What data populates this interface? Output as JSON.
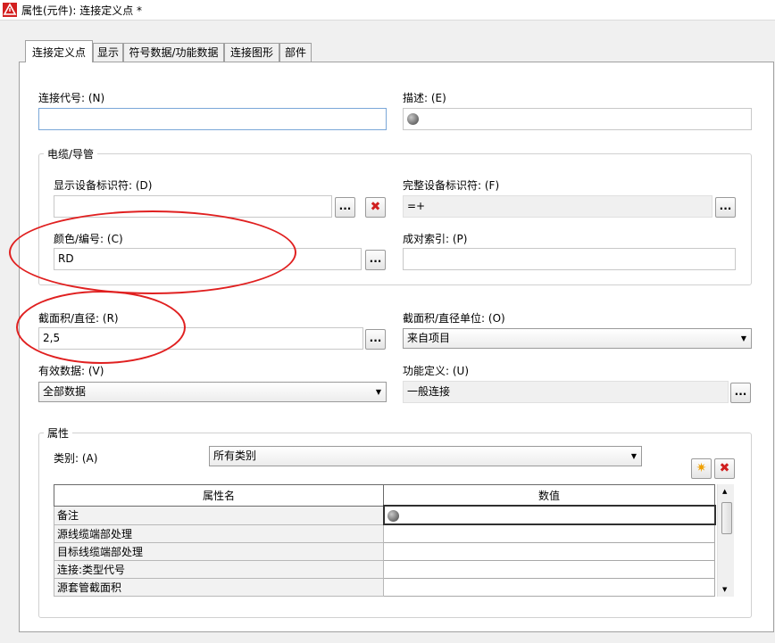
{
  "window": {
    "title": "属性(元件): 连接定义点 *"
  },
  "tabs": [
    {
      "label": "连接定义点",
      "active": true
    },
    {
      "label": "显示",
      "active": false
    },
    {
      "label": "符号数据/功能数据",
      "active": false
    },
    {
      "label": "连接图形",
      "active": false
    },
    {
      "label": "部件",
      "active": false
    }
  ],
  "form": {
    "connection_code": {
      "label": "连接代号: (N)",
      "value": ""
    },
    "description": {
      "label": "描述: (E)",
      "value": ""
    },
    "cable_group": {
      "title": "电缆/导管"
    },
    "display_device_id": {
      "label": "显示设备标识符: (D)",
      "value": ""
    },
    "full_device_id": {
      "label": "完整设备标识符: (F)",
      "value": "=+"
    },
    "color_number": {
      "label": "颜色/编号: (C)",
      "value": "RD"
    },
    "pair_index": {
      "label": "成对索引: (P)",
      "value": ""
    },
    "cross_section": {
      "label": "截面积/直径: (R)",
      "value": "2,5"
    },
    "cross_section_unit": {
      "label": "截面积/直径单位: (O)",
      "value": "来自项目"
    },
    "valid_data": {
      "label": "有效数据: (V)",
      "value": "全部数据"
    },
    "function_def": {
      "label": "功能定义: (U)",
      "value": "一般连接"
    },
    "ellipsis": "..."
  },
  "properties": {
    "group_title": "属性",
    "category_label": "类别: (A)",
    "category_value": "所有类别",
    "columns": [
      "属性名",
      "数值"
    ],
    "rows": [
      {
        "name": "备注",
        "value": ""
      },
      {
        "name": "源线缆端部处理",
        "value": ""
      },
      {
        "name": "目标线缆端部处理",
        "value": ""
      },
      {
        "name": "连接:类型代号",
        "value": ""
      },
      {
        "name": "源套管截面积",
        "value": ""
      }
    ]
  },
  "colors": {
    "annotation": "#e02020",
    "delete": "#d02020",
    "accent_focus": "#7aa7d8"
  }
}
